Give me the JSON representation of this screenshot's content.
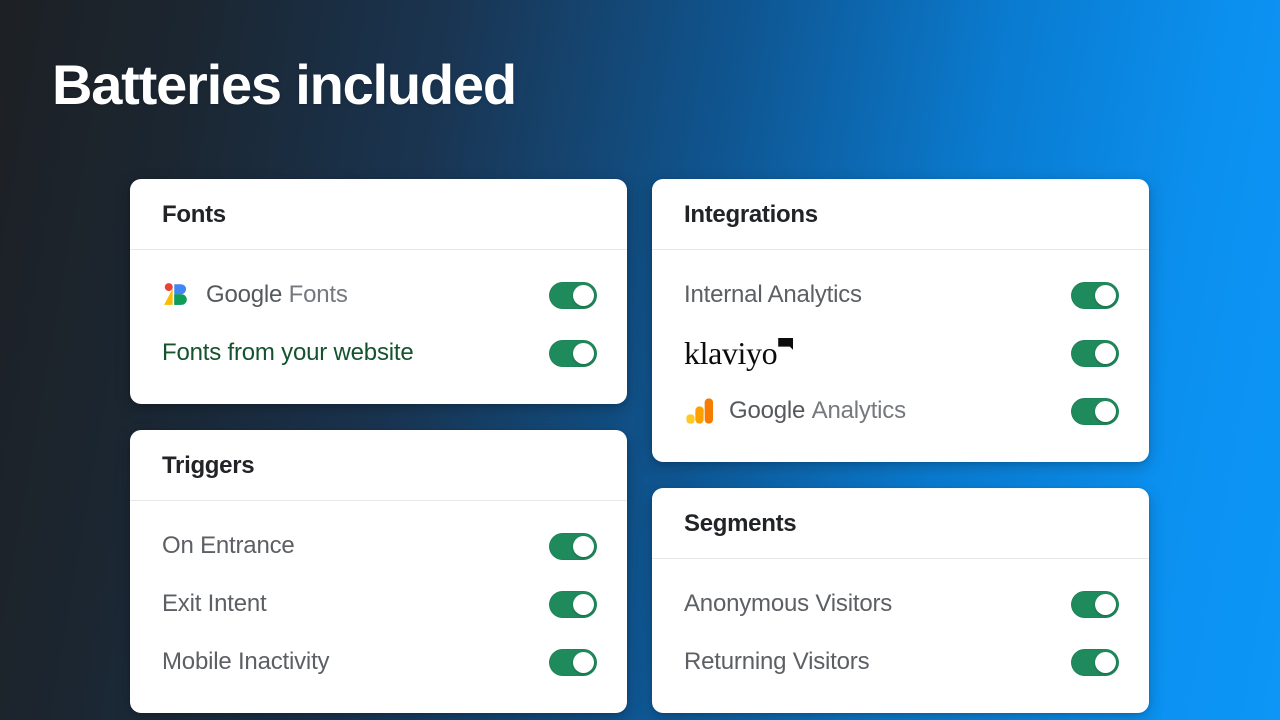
{
  "page": {
    "title": "Batteries included",
    "background_left": "#1d2024",
    "background_right": "#0d96f7",
    "toggle_on_color": "#1f8a5c"
  },
  "cards": [
    {
      "title": "Fonts",
      "rows": [
        {
          "label": "Google Fonts",
          "icon": "google-fonts-logo",
          "toggle": "on"
        },
        {
          "label": "Fonts from your website",
          "icon": "none",
          "toggle": "on"
        }
      ]
    },
    {
      "title": "Integrations",
      "rows": [
        {
          "label": "Internal Analytics",
          "icon": "none",
          "toggle": "on"
        },
        {
          "label": "klaviyo",
          "icon": "klaviyo-logo",
          "toggle": "on"
        },
        {
          "label": "Google Analytics",
          "icon": "google-analytics-logo",
          "toggle": "on"
        }
      ]
    },
    {
      "title": "Triggers",
      "rows": [
        {
          "label": "On Entrance",
          "icon": "none",
          "toggle": "on"
        },
        {
          "label": "Exit Intent",
          "icon": "none",
          "toggle": "on"
        },
        {
          "label": "Mobile Inactivity",
          "icon": "none",
          "toggle": "on"
        }
      ]
    },
    {
      "title": "Segments",
      "rows": [
        {
          "label": "Anonymous Visitors",
          "icon": "none",
          "toggle": "on"
        },
        {
          "label": "Returning Visitors",
          "icon": "none",
          "toggle": "on"
        }
      ]
    }
  ],
  "google_fonts_label": {
    "part1": "Google",
    "part2": "Fonts"
  },
  "google_analytics_label": {
    "part1": "Google",
    "part2": "Analytics"
  },
  "klaviyo_label": "klaviyo"
}
